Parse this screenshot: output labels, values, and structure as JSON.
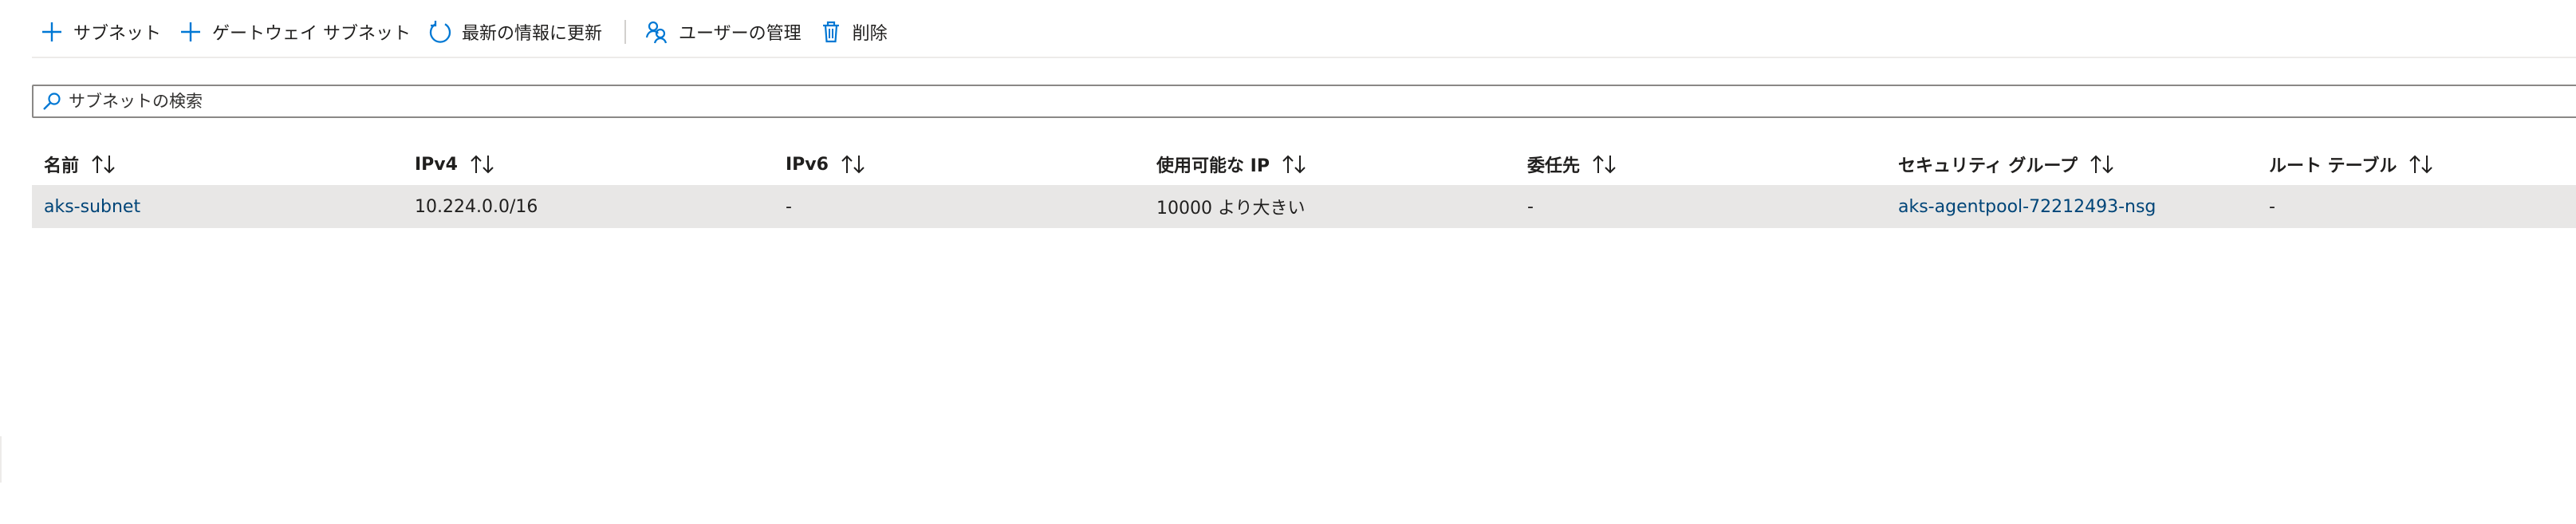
{
  "toolbar": {
    "add_subnet_label": "サブネット",
    "add_gateway_subnet_label": "ゲートウェイ サブネット",
    "refresh_label": "最新の情報に更新",
    "manage_users_label": "ユーザーの管理",
    "delete_label": "削除",
    "icons": [
      "plus-icon",
      "plus-icon",
      "refresh-icon",
      "manage-users-icon",
      "trash-icon"
    ],
    "accent_color": "#0078d4"
  },
  "search": {
    "placeholder": "サブネットの検索",
    "value": ""
  },
  "table": {
    "columns": [
      "名前",
      "IPv4",
      "IPv6",
      "使用可能な IP",
      "委任先",
      "セキュリティ グループ",
      "ルート テーブル"
    ],
    "rows": [
      {
        "name": "aks-subnet",
        "ipv4": "10.224.0.0/16",
        "ipv6": "-",
        "available_ips": "10000 より大きい",
        "delegated_to": "-",
        "security_group": "aks-agentpool-72212493-nsg",
        "route_table": "-"
      }
    ],
    "row_highlight_color": "#e8e7e6",
    "link_color": "#004578"
  }
}
